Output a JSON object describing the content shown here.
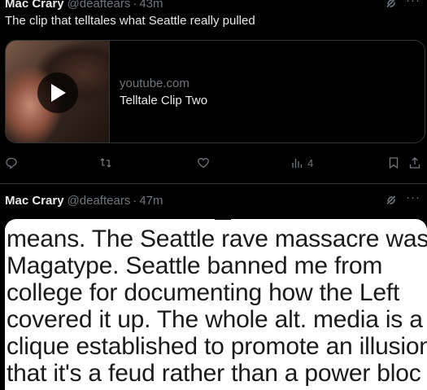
{
  "tweets": [
    {
      "author": "Mac Crary",
      "handle": "@deaftears",
      "time": "43m",
      "text": "The clip that telltales what Seattle really pulled",
      "card": {
        "domain": "youtube.com",
        "title": "Telltale Clip Two"
      },
      "actions": {
        "reply_count": "",
        "retweet_count": "",
        "like_count": "",
        "views": "4"
      }
    },
    {
      "author": "Mac Crary",
      "handle": "@deaftears",
      "time": "47m",
      "image_text_lines": [
        "means.  The Seattle rave massacre was",
        "Magatype.  Seattle banned me from",
        "college for documenting how the Left",
        "covered it up.  The whole alt. media is a",
        "clique established to promote an illusion",
        "that it's a feud rather than a power bloc"
      ]
    }
  ],
  "separator": "·",
  "more_glyph": "···",
  "colors": {
    "text": "#e7e9ea",
    "muted": "#71767b",
    "border": "#2f3336",
    "background": "#000000"
  }
}
